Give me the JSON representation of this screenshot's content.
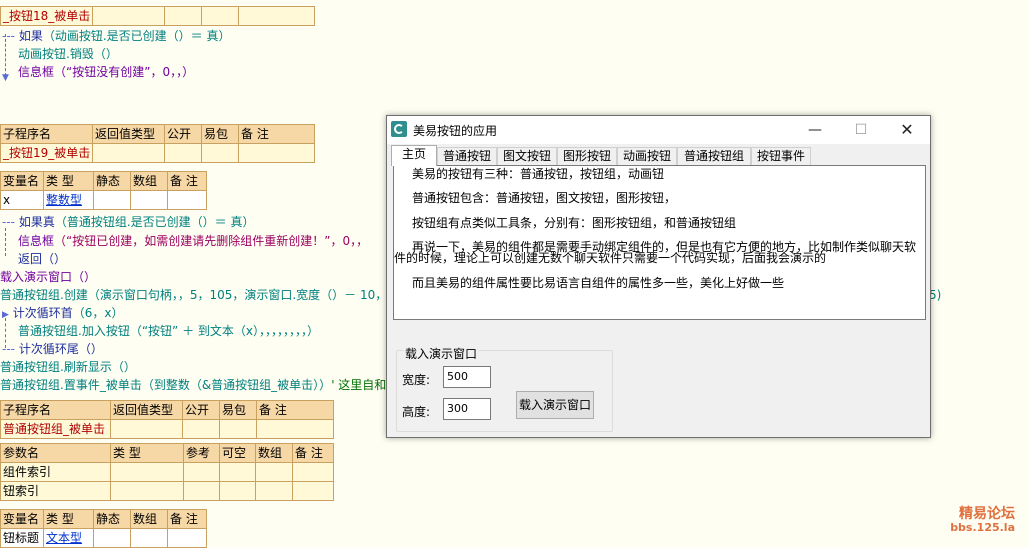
{
  "editor": {
    "top_row": {
      "name": "_按钮18_被单击"
    },
    "block1": {
      "line1_kw": "如果",
      "line1_rest": "（动画按钮.是否已创建（）＝ 真）",
      "line2": "动画按钮.销毁（）",
      "line3_fn": "信息框",
      "line3_rest": "（“按钮没有创建”，0，，）"
    },
    "sub19": {
      "headers": [
        "子程序名",
        "返回值类型",
        "公开",
        "易包",
        "备 注"
      ],
      "name": "_按钮19_被单击",
      "var_headers": [
        "变量名",
        "类 型",
        "静态",
        "数组",
        "备 注"
      ],
      "var_name": "x",
      "var_type": "整数型"
    },
    "block2": {
      "l1_kw": "如果真",
      "l1_rest": "（普通按钮组.是否已创建（）＝ 真）",
      "l2_fn": "信息框",
      "l2_rest": "（“按钮已创建，如需创建请先删除组件重新创建！”，0，，",
      "l3": "返回（）",
      "l4": "载入演示窗口（）",
      "l5": "普通按钮组.创建（演示窗口句柄，，5，105，演示窗口.宽度（）－ 10，",
      "l5_tail": "5)",
      "l6_kw": "计次循环首",
      "l6_rest": "（6，x）",
      "l7": "普通按钮组.加入按钮（“按钮” ＋ 到文本（x），，，，，，，，）",
      "l8_kw": "计次循环尾",
      "l8_rest": "（）",
      "l9": "普通按钮组.刷新显示（）",
      "l10": "普通按钮组.置事件_被单击（到整数（&普通按钮组_被单击））",
      "l10_comment": "' 这里自和"
    },
    "sub_click": {
      "headers": [
        "子程序名",
        "返回值类型",
        "公开",
        "易包",
        "备 注"
      ],
      "name": "普通按钮组_被单击",
      "param_headers": [
        "参数名",
        "类 型",
        "参考",
        "可空",
        "数组",
        "备 注"
      ],
      "param1": "组件索引",
      "param2": "钮索引",
      "var_headers": [
        "变量名",
        "类 型",
        "静态",
        "数组",
        "备 注"
      ],
      "var_name": "钮标题",
      "var_type": "文本型"
    }
  },
  "window": {
    "title": "美易按钮的应用",
    "controls": {
      "minimize": "—",
      "maximize": "☐",
      "close": "✕"
    },
    "tabs": [
      "主页",
      "普通按钮",
      "图文按钮",
      "图形按钮",
      "动画按钮",
      "普通按钮组",
      "按钮事件"
    ],
    "panel": {
      "p1": "美易的按钮有三种：普通按钮，按钮组，动画钮",
      "p2": "普通按钮包含：普通按钮，图文按钮，图形按钮，",
      "p3": "按钮组有点类似工具条，分别有：图形按钮组，和普通按钮组",
      "p4a": "再说一下，美易的组件都是需要手动绑定组件的，但是也有它方便的地方，比如制作类似聊天软",
      "p4b": "件的时候，理论上可以创建无数个聊天软件只需要一个代码实现，后面我会演示的",
      "p5": "而且美易的组件属性要比易语言自组件的属性多一些，美化上好做一些"
    },
    "group": {
      "title": "载入演示窗口",
      "width_label": "宽度:",
      "width_value": "500",
      "height_label": "高度:",
      "height_value": "300",
      "button": "载入演示窗口"
    }
  },
  "watermark": {
    "line1": "精易论坛",
    "line2": "bbs.125.la"
  }
}
